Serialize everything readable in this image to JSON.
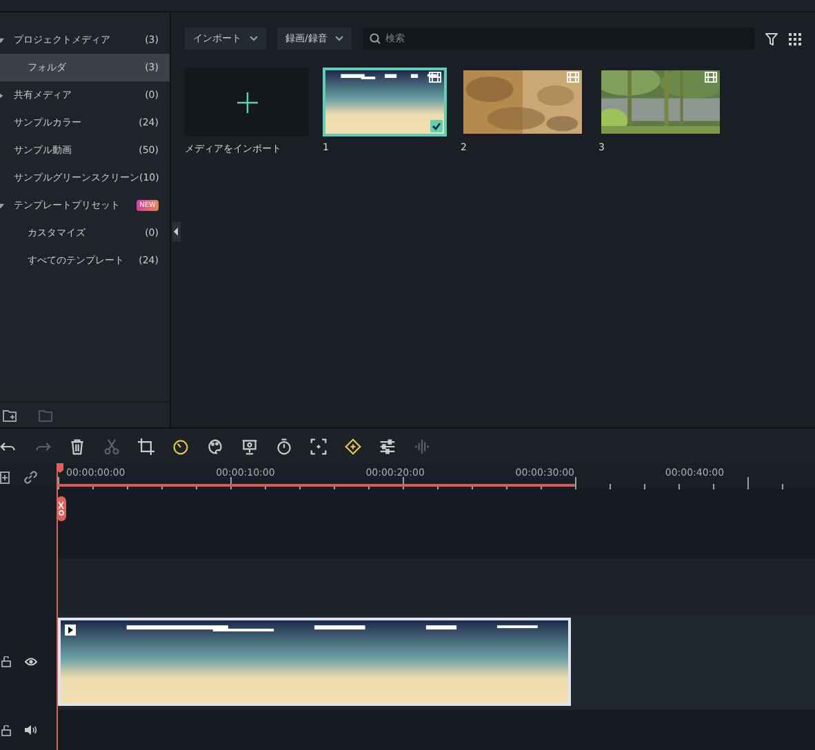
{
  "sidebar": {
    "items": [
      {
        "label": "プロジェクトメディア",
        "count": "(3)",
        "expanded": true,
        "selected": false,
        "children": [
          {
            "label": "フォルダ",
            "count": "(3)",
            "selected": true
          }
        ]
      },
      {
        "label": "共有メディア",
        "count": "(0)",
        "expanded": false,
        "selected": false
      },
      {
        "label": "サンプルカラー",
        "count": "(24)",
        "selected": false
      },
      {
        "label": "サンプル動画",
        "count": "(50)",
        "selected": false
      },
      {
        "label": "サンプルグリーンスクリーン",
        "count": "(10)",
        "selected": false
      },
      {
        "label": "テンプレートプリセット",
        "badge": "NEW",
        "expanded": true,
        "selected": false,
        "children": [
          {
            "label": "カスタマイズ",
            "count": "(0)",
            "selected": false
          },
          {
            "label": "すべてのテンプレート",
            "count": "(24)",
            "selected": false
          }
        ]
      }
    ]
  },
  "media_toolbar": {
    "import_dropdown": "インポート",
    "record_dropdown": "録画/録音",
    "search": {
      "placeholder": "検索"
    }
  },
  "media": {
    "import_tile": "メディアをインポート",
    "items": [
      {
        "label": "1",
        "kind": "gradient",
        "selected": true
      },
      {
        "label": "2",
        "kind": "sand",
        "selected": false
      },
      {
        "label": "3",
        "kind": "forest",
        "selected": false
      }
    ]
  },
  "timeline_toolbar": [
    {
      "kind": "undo",
      "disabled": false,
      "active": false
    },
    {
      "kind": "redo",
      "disabled": true,
      "active": false
    },
    {
      "kind": "delete",
      "disabled": false,
      "active": false
    },
    {
      "kind": "cut",
      "disabled": true,
      "active": false
    },
    {
      "kind": "crop",
      "disabled": false,
      "active": false
    },
    {
      "kind": "speed",
      "disabled": false,
      "active": true
    },
    {
      "kind": "color",
      "disabled": false,
      "active": false
    },
    {
      "kind": "present",
      "disabled": false,
      "active": false
    },
    {
      "kind": "timer",
      "disabled": false,
      "active": false
    },
    {
      "kind": "fit",
      "disabled": false,
      "active": false
    },
    {
      "kind": "keyframe",
      "disabled": false,
      "active": true
    },
    {
      "kind": "adjust",
      "disabled": false,
      "active": false
    },
    {
      "kind": "audio",
      "disabled": true,
      "active": false
    }
  ],
  "ruler": {
    "labels": [
      "00:00:00:00",
      "00:00:10:00",
      "00:00:20:00",
      "00:00:30:00",
      "00:00:40:00"
    ]
  },
  "tracks": [
    {
      "kind": "empty"
    },
    {
      "kind": "empty_alt"
    },
    {
      "kind": "video"
    },
    {
      "kind": "audio"
    }
  ]
}
